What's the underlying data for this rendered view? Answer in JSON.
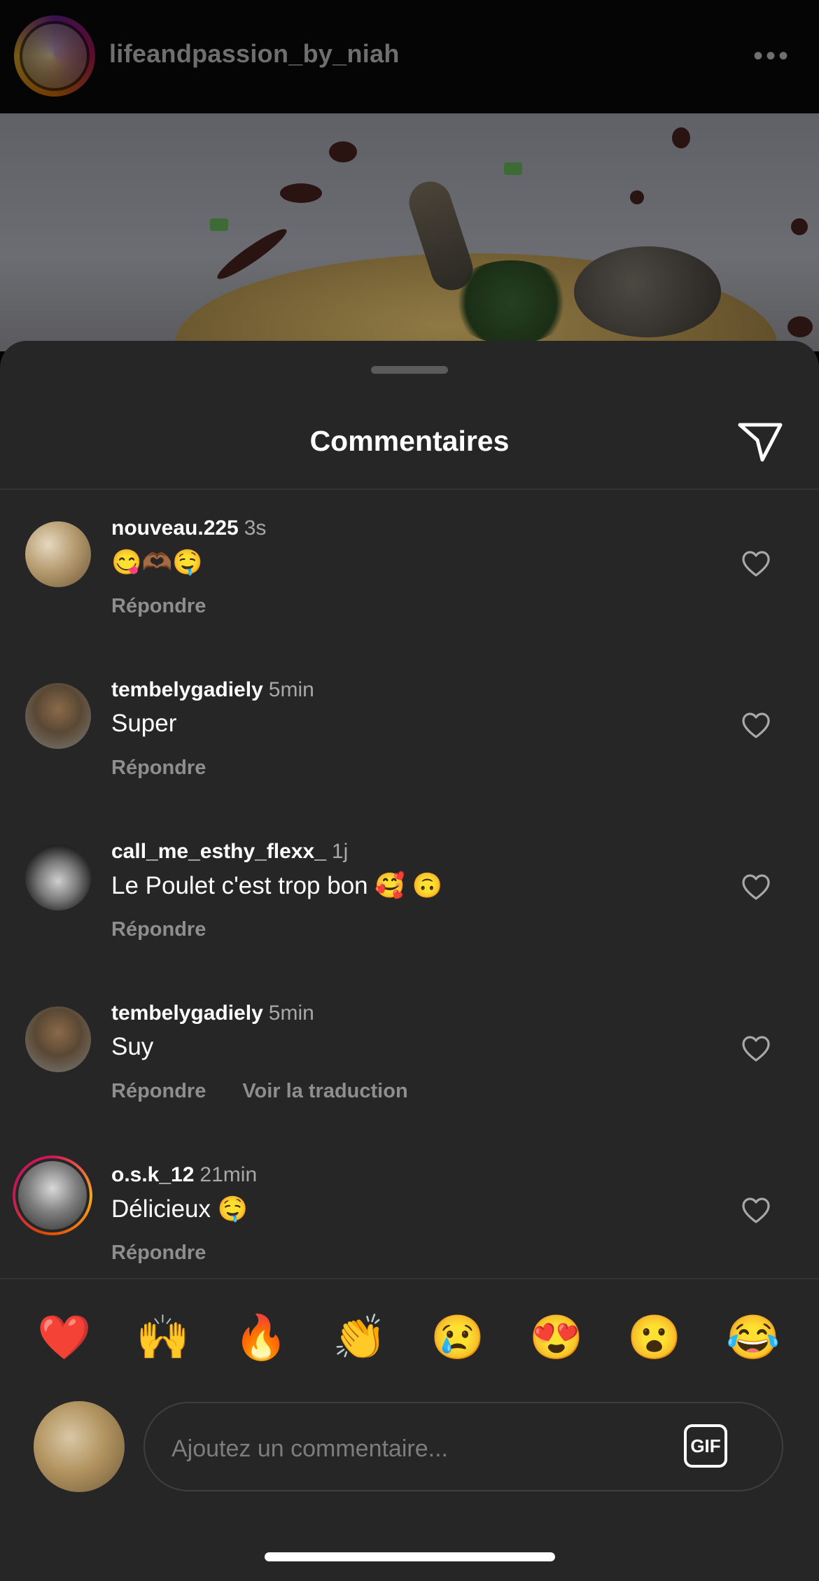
{
  "post": {
    "username": "lifeandpassion_by_niah",
    "more_icon": "more-horizontal-icon"
  },
  "sheet": {
    "title": "Commentaires",
    "share_icon": "send-icon"
  },
  "comments": [
    {
      "user": "nouveau.225",
      "time": "3s",
      "text": "😋🫶🏾🤤",
      "actions": [
        "Répondre"
      ]
    },
    {
      "user": "tembelygadiely",
      "time": "5min",
      "text": "Super",
      "actions": [
        "Répondre"
      ]
    },
    {
      "user": "call_me_esthy_flexx_",
      "time": "1j",
      "text": "Le Poulet c'est trop bon 🥰 🙃",
      "actions": [
        "Répondre"
      ]
    },
    {
      "user": "tembelygadiely",
      "time": "5min",
      "text": "Suy",
      "actions": [
        "Répondre",
        "Voir la traduction"
      ]
    },
    {
      "user": "o.s.k_12",
      "time": "21min",
      "text": "Délicieux 🤤",
      "actions": [
        "Répondre"
      ]
    }
  ],
  "emojis": [
    "❤️",
    "🙌",
    "🔥",
    "👏",
    "😢",
    "😍",
    "😮",
    "😂"
  ],
  "composer": {
    "placeholder": "Ajoutez un commentaire...",
    "gif_label": "GIF"
  }
}
